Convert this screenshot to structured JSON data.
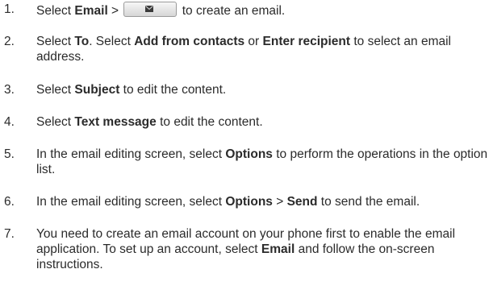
{
  "steps": [
    {
      "num": "1.",
      "parts": [
        {
          "t": "Select "
        },
        {
          "t": "Email",
          "b": true
        },
        {
          "t": " > "
        },
        {
          "icon": "email-button-icon"
        },
        {
          "t": " to create an email."
        }
      ]
    },
    {
      "num": "2.",
      "parts": [
        {
          "t": "Select "
        },
        {
          "t": "To",
          "b": true
        },
        {
          "t": ". Select "
        },
        {
          "t": "Add from contacts",
          "b": true
        },
        {
          "t": " or "
        },
        {
          "t": "Enter recipient",
          "b": true
        },
        {
          "t": " to select an email address."
        }
      ]
    },
    {
      "num": "3.",
      "parts": [
        {
          "t": "Select "
        },
        {
          "t": "Subject",
          "b": true
        },
        {
          "t": " to edit the content."
        }
      ]
    },
    {
      "num": "4.",
      "parts": [
        {
          "t": "Select "
        },
        {
          "t": "Text message",
          "b": true
        },
        {
          "t": " to edit the content."
        }
      ]
    },
    {
      "num": "5.",
      "parts": [
        {
          "t": "In the email editing screen, select "
        },
        {
          "t": "Options",
          "b": true
        },
        {
          "t": " to perform the operations in the option list."
        }
      ]
    },
    {
      "num": "6.",
      "parts": [
        {
          "t": "In the email editing screen, select "
        },
        {
          "t": "Options",
          "b": true
        },
        {
          "t": " > "
        },
        {
          "t": "Send",
          "b": true
        },
        {
          "t": " to send the email."
        }
      ]
    },
    {
      "num": "7.",
      "parts": [
        {
          "t": "You need to create an email account on your phone first to enable the email application. To set up an account, select "
        },
        {
          "t": "Email",
          "b": true
        },
        {
          "t": " and follow the on-screen instructions."
        }
      ]
    }
  ]
}
